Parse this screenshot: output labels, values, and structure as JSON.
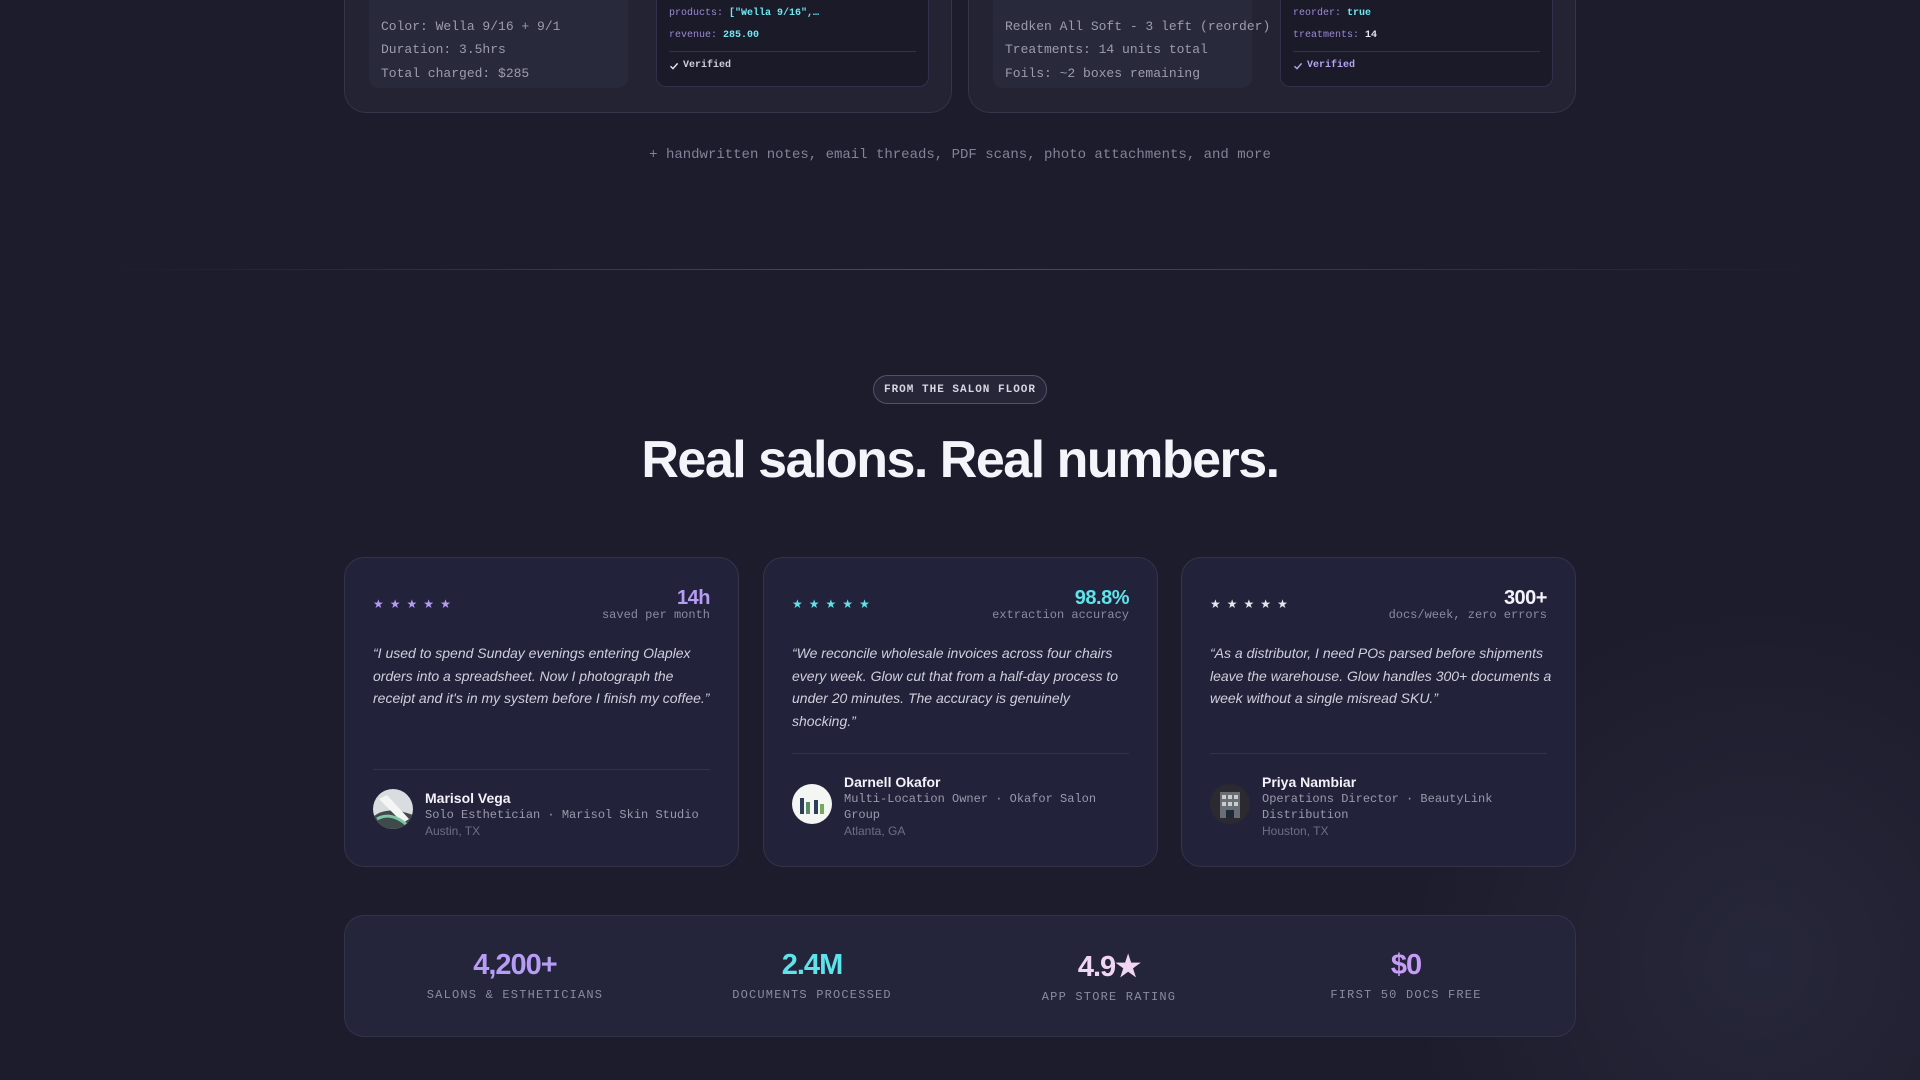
{
  "top": {
    "left_raw_lines": [
      "Color: Wella 9/16 + 9/1",
      "Duration: 3.5hrs",
      "Total charged: $285"
    ],
    "left_json": {
      "products_key": "products:",
      "products_val": "[\"Wella 9/16\",…",
      "revenue_key": "revenue:",
      "revenue_val": "285.00",
      "verified": "Verified"
    },
    "right_raw_lines": [
      "Redken All Soft - 3 left (reorder)",
      "Treatments: 14 units total",
      "Foils: ~2 boxes remaining"
    ],
    "right_json": {
      "reorder_key": "reorder:",
      "reorder_val": "true",
      "treatments_key": "treatments:",
      "treatments_val": "14",
      "verified": "Verified"
    },
    "more_note": "+ handwritten notes, email threads, PDF scans, photo attachments, and more"
  },
  "testimonials": {
    "eyebrow": "FROM THE SALON FLOOR",
    "headline": "Real salons. Real numbers.",
    "cards": [
      {
        "stars": "★★★★★",
        "star_color": "#b79cf5",
        "stat": "14h",
        "stat_color": "#b79cf5",
        "stat_sub": "saved per month",
        "quote": "“I used to spend Sunday evenings entering Olaplex orders into a spreadsheet. Now I photograph the receipt and it's in my system before I finish my coffee.”",
        "name": "Marisol Vega",
        "role": "Solo Esthetician · Marisol Skin Studio",
        "location": "Austin, TX"
      },
      {
        "stars": "★★★★★",
        "star_color": "#5fe3ea",
        "stat": "98.8%",
        "stat_color": "#5fe3ea",
        "stat_sub": "extraction accuracy",
        "quote": "“We reconcile wholesale invoices across four chairs every week. Glow cut that from a half-day process to under 20 minutes. The accuracy is genuinely shocking.”",
        "name": "Darnell Okafor",
        "role": "Multi-Location Owner · Okafor Salon Group",
        "location": "Atlanta, GA"
      },
      {
        "stars": "★★★★★",
        "star_color": "#e6e6f0",
        "stat": "300+",
        "stat_color": "#f2f2f8",
        "stat_sub": "docs/week, zero errors",
        "quote": "“As a distributor, I need POs parsed before shipments leave the warehouse. Glow handles 300+ documents a week without a single misread SKU.”",
        "name": "Priya Nambiar",
        "role": "Operations Director · BeautyLink Distribution",
        "location": "Houston, TX"
      }
    ]
  },
  "stats": [
    {
      "value": "4,200+",
      "label": "SALONS & ESTHETICIANS",
      "color": "#b79cf5"
    },
    {
      "value": "2.4M",
      "label": "DOCUMENTS PROCESSED",
      "color": "#5fe3ea"
    },
    {
      "value": "4.9★",
      "label": "APP STORE RATING",
      "color": "#f0d6f0"
    },
    {
      "value": "$0",
      "label": "FIRST 50 DOCS FREE",
      "color": "#c79cf5"
    }
  ]
}
